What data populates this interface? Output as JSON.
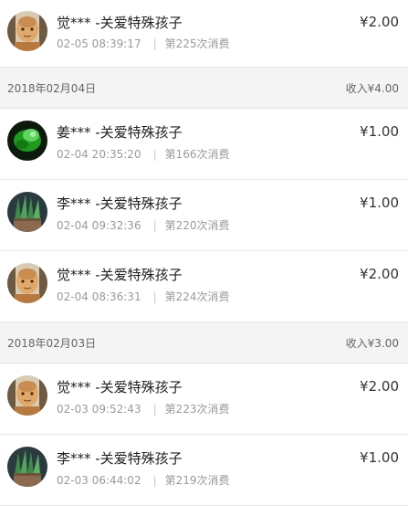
{
  "colors": {
    "header_bg": "#f4f4f4",
    "text_primary": "#222222",
    "text_secondary": "#9a9a9a"
  },
  "groups": [
    {
      "date": "",
      "income": "",
      "records": [
        {
          "avatar": "monk-avatar",
          "name": "觉*** -关爱特殊孩子",
          "time": "02-05 08:39:17",
          "count": "第225次消费",
          "amount": "¥2.00"
        }
      ]
    },
    {
      "date": "2018年02月04日",
      "income": "收入¥4.00",
      "records": [
        {
          "avatar": "green-plant-avatar",
          "name": "姜*** -关爱特殊孩子",
          "time": "02-04 20:35:20",
          "count": "第166次消费",
          "amount": "¥1.00"
        },
        {
          "avatar": "plant-pot-avatar",
          "name": "李*** -关爱特殊孩子",
          "time": "02-04 09:32:36",
          "count": "第220次消费",
          "amount": "¥1.00"
        },
        {
          "avatar": "monk-avatar",
          "name": "觉*** -关爱特殊孩子",
          "time": "02-04 08:36:31",
          "count": "第224次消费",
          "amount": "¥2.00"
        }
      ]
    },
    {
      "date": "2018年02月03日",
      "income": "收入¥3.00",
      "records": [
        {
          "avatar": "monk-avatar",
          "name": "觉*** -关爱特殊孩子",
          "time": "02-03 09:52:43",
          "count": "第223次消费",
          "amount": "¥2.00"
        },
        {
          "avatar": "plant-pot-avatar",
          "name": "李*** -关爱特殊孩子",
          "time": "02-03 06:44:02",
          "count": "第219次消费",
          "amount": "¥1.00"
        }
      ]
    }
  ]
}
